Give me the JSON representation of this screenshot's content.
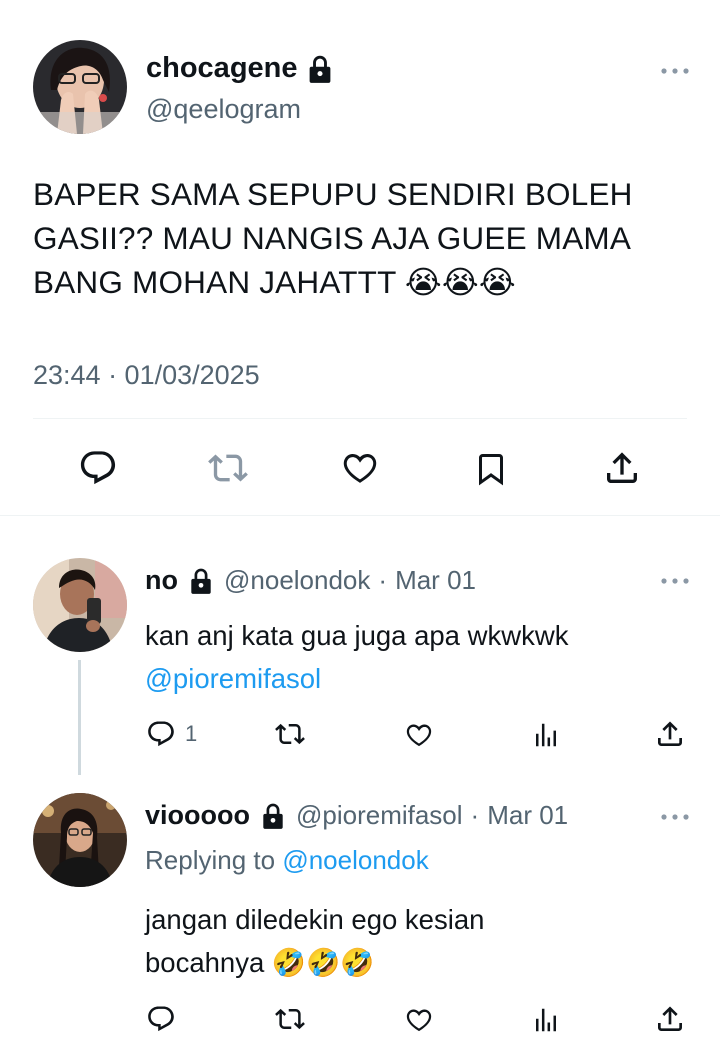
{
  "main_post": {
    "display_name": "chocagene",
    "handle": "@qeelogram",
    "text": "BAPER SAMA SEPUPU SENDIRI BOLEH GASII?? MAU NANGIS AJA GUEE MAMA BANG MOHAN JAHATTT 😭😭😭",
    "timestamp": "23:44 · 01/03/2025",
    "actions": [
      "reply-icon",
      "retweet-icon",
      "like-icon",
      "bookmark-icon",
      "share-icon"
    ]
  },
  "replies": [
    {
      "display_name": "no",
      "handle": "@noelondok",
      "date": "Mar 01",
      "text": "kan anj kata gua juga apa wkwkwk",
      "mention": "@pioremifasol",
      "reply_count": "1"
    },
    {
      "display_name": "viooooo",
      "handle": "@pioremifasol",
      "date": "Mar 01",
      "replying_label": "Replying to",
      "replying_to": "@noelondok",
      "text_line1": "jangan diledekin ego kesian",
      "text_line2": "bocahnya 🤣🤣🤣"
    }
  ],
  "colors": {
    "text": "#0f1419",
    "secondary": "#536471",
    "link": "#1d9bf0",
    "divider": "#eff3f4"
  }
}
